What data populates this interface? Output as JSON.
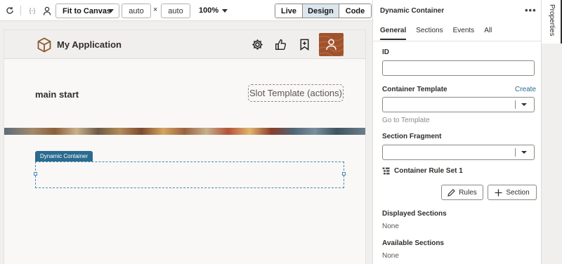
{
  "toolbar": {
    "refresh_icon": "refresh-icon",
    "variable_icon": "variable-braces-icon",
    "person_icon": "person-icon",
    "fit_label": "Fit to Canvas",
    "width_value": "auto",
    "times": "×",
    "height_value": "auto",
    "zoom": "100%",
    "modes": [
      "Live",
      "Design",
      "Code"
    ],
    "active_mode": "Design"
  },
  "app": {
    "title": "My Application",
    "icons": [
      "gear-icon",
      "thumbs-up-icon",
      "bookmark-icon",
      "avatar"
    ],
    "main_start": "main start",
    "slot_label": "Slot Template (actions)",
    "dc_tag": "Dynamic Container"
  },
  "panel": {
    "title": "Dynamic Container",
    "menu": "•••",
    "tabs": [
      "General",
      "Sections",
      "Events",
      "All"
    ],
    "active_tab": "General",
    "id_label": "ID",
    "id_value": "",
    "container_template_label": "Container Template",
    "create_link": "Create",
    "go_to_template": "Go to Template",
    "section_fragment_label": "Section Fragment",
    "rule_set": "Container Rule Set 1",
    "rules_button": "Rules",
    "section_button": "Section",
    "displayed_sections_label": "Displayed Sections",
    "displayed_sections_value": "None",
    "available_sections_label": "Available Sections",
    "available_sections_value": "None"
  },
  "side": {
    "tab_label": "Properties"
  }
}
